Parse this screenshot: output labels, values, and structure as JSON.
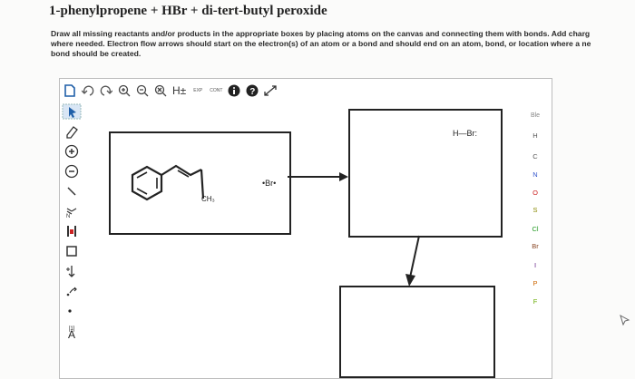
{
  "title": "1-phenylpropene + HBr + di-tert-butyl peroxide",
  "instructions": [
    "Draw all missing reactants and/or products in the appropriate boxes by placing atoms on the canvas and connecting them with bonds. Add charg",
    "where needed. Electron flow arrows should start on the electron(s) of an atom or a bond and should end on an atom, bond, or location where a ne",
    "bond should be created."
  ],
  "toolbar": {
    "hydrogen_label": "H±",
    "exp_label": "EXP",
    "cont_label": "CONT"
  },
  "left_tools": {
    "charge_label": "[1]",
    "atom_label": "A"
  },
  "periodic": {
    "header": "Ble",
    "elements": [
      "H",
      "C",
      "N",
      "O",
      "S",
      "Cl",
      "Br",
      "I",
      "P",
      "F"
    ]
  },
  "boxes": {
    "reactant": {
      "substituent": "CH₃",
      "radical": "•Br•"
    },
    "top_right": {
      "molecule": "H—Br:"
    },
    "bottom_right": {}
  },
  "colors": {
    "element_colors": [
      "#555555",
      "#555555",
      "#3355cc",
      "#cc2222",
      "#888800",
      "#229922",
      "#884422",
      "#662288",
      "#cc6600",
      "#66aa00"
    ]
  }
}
